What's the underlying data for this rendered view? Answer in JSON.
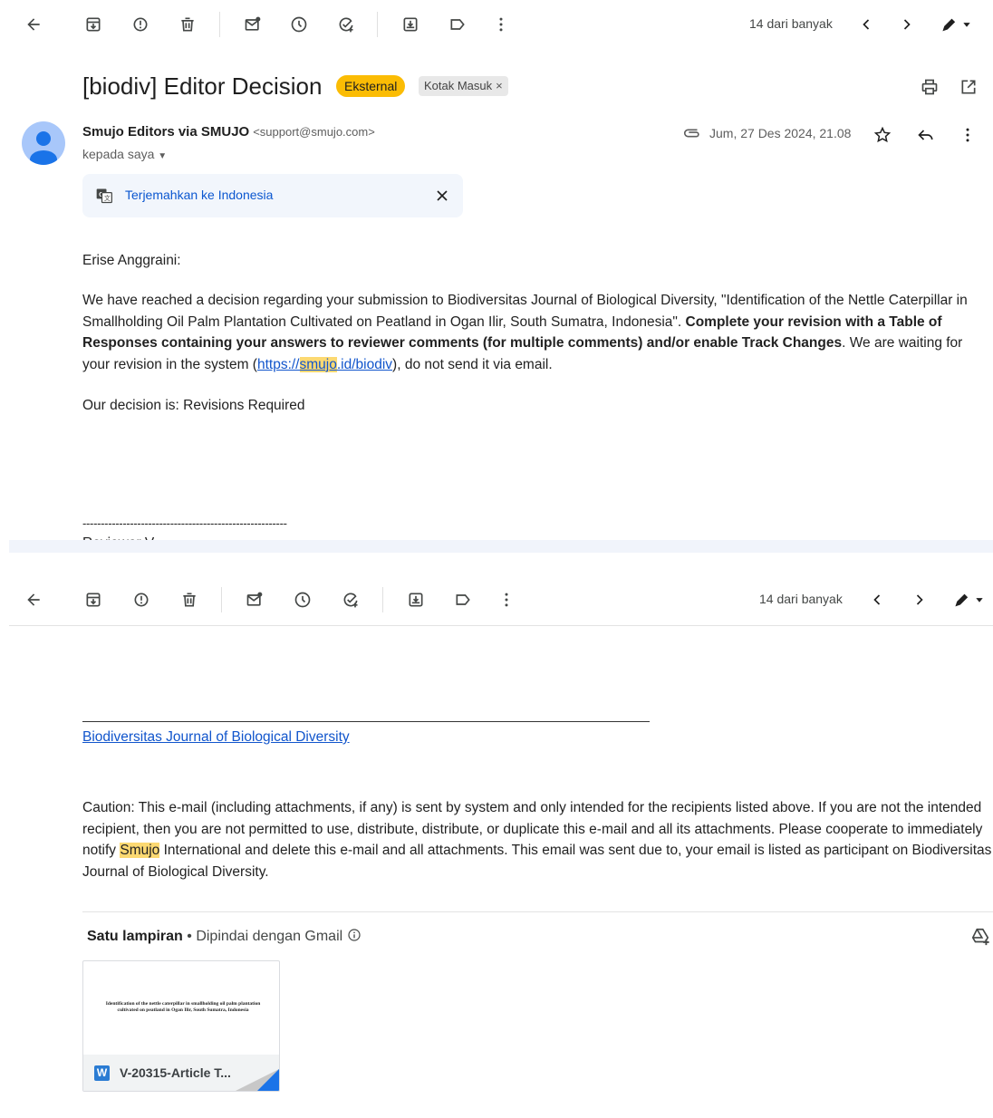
{
  "toolbar": {
    "pager": "14 dari banyak",
    "icons": [
      "back-arrow-icon",
      "archive-icon",
      "report-spam-icon",
      "delete-icon",
      "mark-unread-icon",
      "snooze-icon",
      "add-task-icon",
      "move-to-icon",
      "label-icon",
      "more-vert-icon",
      "chevron-left-icon",
      "chevron-right-icon",
      "pen-dropdown-icon"
    ]
  },
  "email": {
    "subject": "[biodiv] Editor Decision",
    "badge_external": "Eksternal",
    "label_chip": "Kotak Masuk",
    "label_chip_close": "×",
    "sender_name": "Smujo Editors via SMUJO",
    "sender_address": "<support@smujo.com>",
    "recipient": "kepada saya",
    "date": "Jum, 27 Des 2024, 21.08",
    "translate_label": "Terjemahkan ke Indonesia"
  },
  "body": {
    "greeting": "Erise Anggraini:",
    "p1_a": "We have reached a decision regarding your submission to Biodiversitas Journal of Biological Diversity, \"Identification of the Nettle Caterpillar in Smallholding Oil Palm Plantation Cultivated on Peatland in Ogan Ilir, South Sumatra, Indonesia\". ",
    "p1_bold": "Complete your revision with a Table of Responses containing your answers to reviewer comments (for multiple comments) and/or enable Track Changes",
    "p1_b": ". We are waiting for your revision in the system (",
    "p1_link_a": "https://",
    "p1_link_hl": "smujo",
    "p1_link_b": ".id/biodiv",
    "p1_c": "), do not send it via email.",
    "decision": "Our decision is: Revisions Required",
    "dashes": "--------------------------------------------------------",
    "cut_text": "Reviewer V",
    "journal_link": "Biodiversitas Journal of Biological Diversity",
    "caution_a": "Caution: This e-mail (including attachments, if any) is sent by system and only intended for the recipients listed above. If you are not the intended recipient, then you are not permitted to use, distribute, distribute, or duplicate this e-mail and all its attachments. Please cooperate to immediately notify ",
    "caution_hl": "Smujo",
    "caution_b": " International and delete this e-mail and all attachments. This email was sent due to, your email is listed as participant on Biodiversitas Journal of Biological Diversity."
  },
  "attachments": {
    "count_label": "Satu lampiran",
    "scan_label": "Dipindai dengan Gmail",
    "preview_text": "Identification of the nettle caterpillar in smallholding oil palm plantation cultivated on peatland in Ogan Ilir, South Sumatra, Indonesia",
    "file_name": "V-20315-Article T...",
    "file_type": "W"
  },
  "colors": {
    "badge_external": "#fbbc04",
    "link": "#1155cc",
    "highlight": "#fcd972",
    "translate_bg": "#f2f6fc"
  }
}
